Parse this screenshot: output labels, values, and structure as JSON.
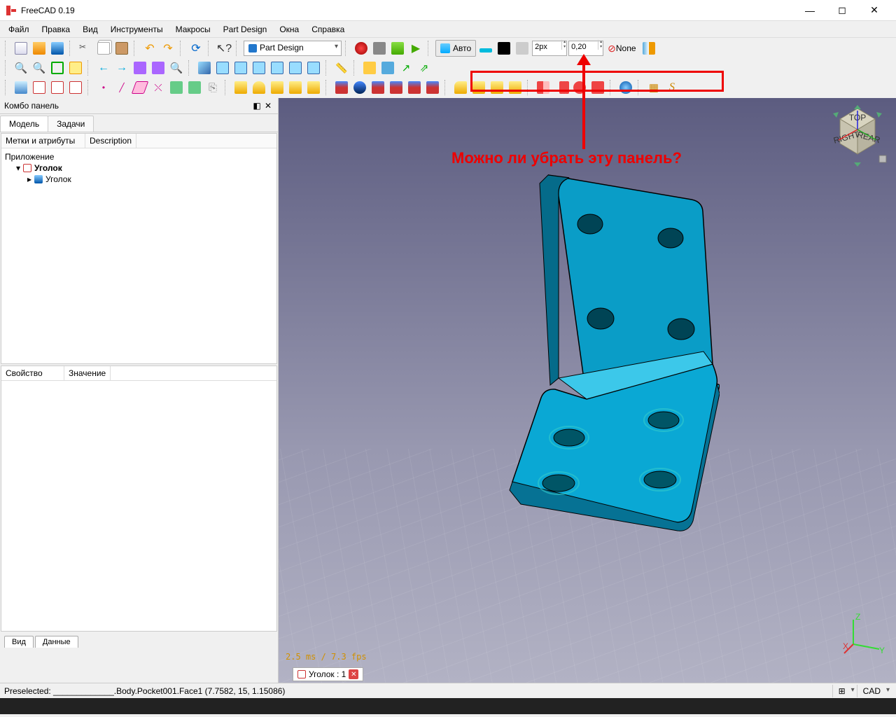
{
  "title": "FreeCAD 0.19",
  "menu": [
    "Файл",
    "Правка",
    "Вид",
    "Инструменты",
    "Макросы",
    "Part Design",
    "Окна",
    "Справка"
  ],
  "workbench_selector": "Part Design",
  "draft_panel": {
    "auto": "Авто",
    "px": "2px",
    "val": "0,20",
    "none": "None"
  },
  "annotation": "Можно ли убрать эту панель?",
  "combo_panel_title": "Комбо панель",
  "model_tab": "Модель",
  "tasks_tab": "Задачи",
  "col_labels": "Метки и атрибуты",
  "col_desc": "Description",
  "tree": {
    "app": "Приложение",
    "doc": "Уголок",
    "body": "Уголок"
  },
  "prop": {
    "name": "Свойство",
    "value": "Значение"
  },
  "bottom_tabs": [
    "Вид",
    "Данные"
  ],
  "perf": "2.5 ms / 7.3 fps",
  "doc_tab": "Уголок : 1",
  "status_preselect": "Preselected: _____________.Body.Pocket001.Face1 (7.7582, 15, 1.15086)",
  "status_cad": "CAD",
  "axes": {
    "x": "X",
    "y": "Y",
    "z": "Z"
  },
  "cube": {
    "top": "TOP",
    "right": "RIGHT",
    "rear": "REAR"
  }
}
